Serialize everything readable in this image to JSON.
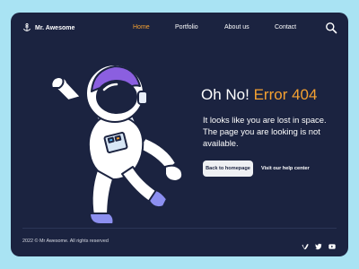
{
  "colors": {
    "page_bg": "#a9e3f3",
    "panel_bg": "#1b2340",
    "accent": "#f5a131",
    "text": "#ffffff",
    "button_bg": "#eef0f3"
  },
  "header": {
    "brand_icon": "anchor-icon",
    "brand_name": "Mr. Awesome",
    "nav": [
      {
        "label": "Home",
        "active": true
      },
      {
        "label": "Portfolio",
        "active": false
      },
      {
        "label": "About us",
        "active": false
      },
      {
        "label": "Contact",
        "active": false
      }
    ],
    "search_icon": "search-icon"
  },
  "main": {
    "title_prefix": "Oh No!",
    "title_accent": "Error 404",
    "description": "It looks like you are lost in space. The page you are looking is not available.",
    "primary_button": "Back to homepage",
    "secondary_link": "Visit our help center",
    "illustration": "astronaut-illustration"
  },
  "footer": {
    "copyright": "2022 © Mr Awesome. All rights reserved",
    "social_icons": [
      "vimeo-icon",
      "twitter-icon",
      "youtube-icon"
    ]
  }
}
